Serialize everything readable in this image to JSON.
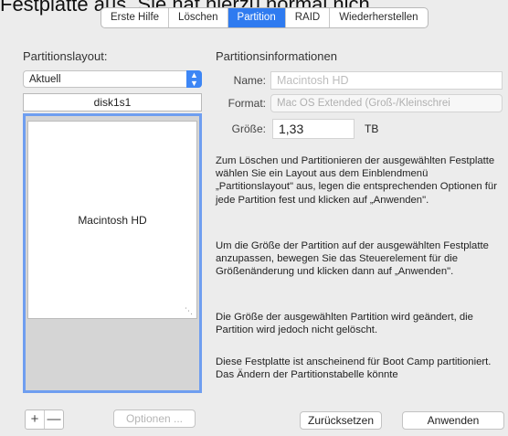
{
  "background_text": "Festplatte aus. Sie hat hierzu normal nich",
  "tabs": [
    {
      "label": "Erste Hilfe",
      "active": false
    },
    {
      "label": "Löschen",
      "active": false
    },
    {
      "label": "Partition",
      "active": true
    },
    {
      "label": "RAID",
      "active": false
    },
    {
      "label": "Wiederherstellen",
      "active": false
    }
  ],
  "left": {
    "layout_label": "Partitionslayout:",
    "layout_select": "Aktuell",
    "disk_name": "disk1s1",
    "partition_name": "Macintosh HD",
    "add_glyph": "+",
    "remove_glyph": "—",
    "options_button": "Optionen ..."
  },
  "info": {
    "title": "Partitionsinformationen",
    "name_label": "Name:",
    "name_value": "Macintosh HD",
    "format_label": "Format:",
    "format_value": "Mac OS Extended (Groß-/Kleinschrei",
    "size_label": "Größe:",
    "size_value": "1,33",
    "size_unit": "TB",
    "paragraphs": [
      "Zum Löschen und Partitionieren der ausgewählten Festplatte wählen Sie ein Layout aus dem Einblendmenü „Partitionslayout\" aus, legen die entsprechenden Optionen für jede Partition fest und klicken auf „Anwenden\".",
      "Um die Größe der Partition auf der ausgewählten Festplatte anzupassen, bewegen Sie das Steuerelement für die Größenänderung und klicken dann auf „Anwenden\".",
      "Die Größe der ausgewählten Partition wird geändert, die Partition wird jedoch nicht gelöscht.",
      "Diese Festplatte ist anscheinend für Boot Camp partitioniert. Das Ändern der Partitionstabelle könnte"
    ]
  },
  "buttons": {
    "reset": "Zurücksetzen",
    "apply": "Anwenden"
  },
  "colors": {
    "accent": "#2f7bf0",
    "selection_border": "#6f9ef0"
  }
}
